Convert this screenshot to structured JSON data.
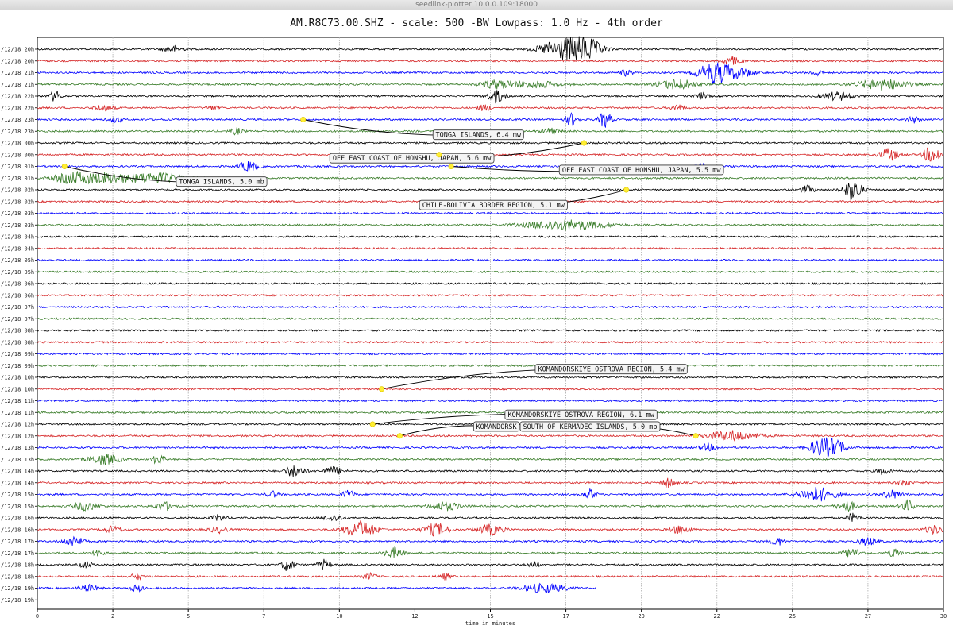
{
  "window": {
    "title": "seedlink-plotter 10.0.0.109:18000"
  },
  "chart_data": {
    "type": "line",
    "title": "AM.R8C73.00.SHZ - scale: 500 -BW Lowpass: 1.0 Hz - 4th order",
    "xlabel": "time in minutes",
    "ylabel": "",
    "xlim": [
      0,
      30
    ],
    "grid": true,
    "x_ticks": [
      "0",
      "2",
      "5",
      "7",
      "10",
      "12",
      "15",
      "17",
      "20",
      "22",
      "25",
      "27",
      "30"
    ],
    "x_tick_values": [
      0,
      2.5,
      5,
      7.5,
      10,
      12.5,
      15,
      17.5,
      20,
      22.5,
      25,
      27.5,
      30
    ],
    "color_cycle": [
      "#000000",
      "#d62728",
      "#0000ff",
      "#3a7d2a"
    ],
    "rows": [
      {
        "label": "/12/18 20h",
        "last_minute": 30,
        "bursts": [
          [
            4.5,
            0.3,
            0.3
          ],
          [
            17.4,
            0.7,
            1.0
          ],
          [
            18.2,
            0.5,
            0.9
          ]
        ]
      },
      {
        "label": "/12/18 20h",
        "last_minute": 30,
        "bursts": [
          [
            23.0,
            0.3,
            0.4
          ]
        ]
      },
      {
        "label": "/12/18 21h",
        "last_minute": 30,
        "bursts": [
          [
            19.5,
            0.2,
            0.3
          ],
          [
            22.4,
            0.5,
            1.0
          ],
          [
            23.2,
            0.5,
            0.5
          ],
          [
            25.8,
            0.2,
            0.3
          ]
        ]
      },
      {
        "label": "/12/18 21h",
        "last_minute": 30,
        "bursts": [
          [
            15.2,
            0.5,
            0.4
          ],
          [
            16.5,
            0.8,
            0.3
          ],
          [
            21.2,
            0.6,
            0.5
          ],
          [
            28.0,
            0.8,
            0.5
          ]
        ]
      },
      {
        "label": "/12/18 22h",
        "last_minute": 30,
        "bursts": [
          [
            0.6,
            0.2,
            0.5
          ],
          [
            15.2,
            0.3,
            0.6
          ],
          [
            22.0,
            0.2,
            0.3
          ],
          [
            26.5,
            0.5,
            0.4
          ]
        ]
      },
      {
        "label": "/12/18 22h",
        "last_minute": 30,
        "bursts": [
          [
            2.2,
            0.3,
            0.3
          ],
          [
            5.8,
            0.2,
            0.2
          ],
          [
            14.8,
            0.2,
            0.3
          ],
          [
            21.2,
            0.2,
            0.3
          ]
        ]
      },
      {
        "label": "/12/18 23h",
        "last_minute": 30,
        "bursts": [
          [
            2.6,
            0.2,
            0.3
          ],
          [
            17.7,
            0.2,
            0.6
          ],
          [
            18.8,
            0.2,
            0.8
          ],
          [
            29.0,
            0.2,
            0.3
          ]
        ]
      },
      {
        "label": "/12/18 23h",
        "last_minute": 30,
        "bursts": [
          [
            6.6,
            0.2,
            0.3
          ],
          [
            17.0,
            0.3,
            0.3
          ]
        ]
      },
      {
        "label": "/12/18 00h",
        "last_minute": 30,
        "bursts": []
      },
      {
        "label": "/12/18 00h",
        "last_minute": 30,
        "bursts": [
          [
            28.2,
            0.3,
            0.6
          ],
          [
            29.5,
            0.2,
            0.6
          ],
          [
            29.8,
            0.2,
            0.5
          ]
        ]
      },
      {
        "label": "/12/18 01h",
        "last_minute": 30,
        "bursts": [
          [
            7.0,
            0.3,
            0.5
          ],
          [
            22.0,
            0.2,
            0.3
          ]
        ]
      },
      {
        "label": "/12/18 01h",
        "last_minute": 30,
        "bursts": [
          [
            1.3,
            0.7,
            0.6
          ],
          [
            2.4,
            0.5,
            0.4
          ],
          [
            3.8,
            1.0,
            0.5
          ]
        ]
      },
      {
        "label": "/12/18 02h",
        "last_minute": 30,
        "bursts": [
          [
            25.5,
            0.2,
            0.4
          ],
          [
            27.0,
            0.3,
            1.0
          ]
        ]
      },
      {
        "label": "/12/18 02h",
        "last_minute": 30,
        "bursts": []
      },
      {
        "label": "/12/18 03h",
        "last_minute": 30,
        "bursts": []
      },
      {
        "label": "/12/18 03h",
        "last_minute": 30,
        "bursts": [
          [
            17.5,
            1.3,
            0.5
          ]
        ]
      },
      {
        "label": "/12/18 04h",
        "last_minute": 30,
        "bursts": []
      },
      {
        "label": "/12/18 04h",
        "last_minute": 30,
        "bursts": []
      },
      {
        "label": "/12/18 05h",
        "last_minute": 30,
        "bursts": []
      },
      {
        "label": "/12/18 05h",
        "last_minute": 30,
        "bursts": []
      },
      {
        "label": "/12/18 06h",
        "last_minute": 30,
        "bursts": []
      },
      {
        "label": "/12/18 06h",
        "last_minute": 30,
        "bursts": []
      },
      {
        "label": "/12/18 07h",
        "last_minute": 30,
        "bursts": []
      },
      {
        "label": "/12/18 07h",
        "last_minute": 30,
        "bursts": []
      },
      {
        "label": "/12/18 08h",
        "last_minute": 30,
        "bursts": []
      },
      {
        "label": "/12/18 08h",
        "last_minute": 30,
        "bursts": []
      },
      {
        "label": "/12/18 09h",
        "last_minute": 30,
        "bursts": []
      },
      {
        "label": "/12/18 09h",
        "last_minute": 30,
        "bursts": []
      },
      {
        "label": "/12/18 10h",
        "last_minute": 30,
        "bursts": []
      },
      {
        "label": "/12/18 10h",
        "last_minute": 30,
        "bursts": []
      },
      {
        "label": "/12/18 11h",
        "last_minute": 30,
        "bursts": []
      },
      {
        "label": "/12/18 11h",
        "last_minute": 30,
        "bursts": []
      },
      {
        "label": "/12/18 12h",
        "last_minute": 30,
        "bursts": []
      },
      {
        "label": "/12/18 12h",
        "last_minute": 30,
        "bursts": [
          [
            23.0,
            0.8,
            0.5
          ]
        ]
      },
      {
        "label": "/12/18 13h",
        "last_minute": 30,
        "bursts": [
          [
            22.2,
            0.3,
            0.3
          ],
          [
            26.0,
            0.4,
            0.9
          ],
          [
            26.5,
            0.3,
            0.5
          ]
        ]
      },
      {
        "label": "/12/18 13h",
        "last_minute": 30,
        "bursts": [
          [
            2.2,
            0.5,
            0.5
          ],
          [
            4.0,
            0.2,
            0.5
          ]
        ]
      },
      {
        "label": "/12/18 14h",
        "last_minute": 30,
        "bursts": [
          [
            8.5,
            0.3,
            0.6
          ],
          [
            9.8,
            0.3,
            0.4
          ],
          [
            28.0,
            0.2,
            0.3
          ]
        ]
      },
      {
        "label": "/12/18 14h",
        "last_minute": 30,
        "bursts": [
          [
            20.9,
            0.2,
            0.5
          ],
          [
            28.7,
            0.2,
            0.3
          ]
        ]
      },
      {
        "label": "/12/18 15h",
        "last_minute": 30,
        "bursts": [
          [
            7.8,
            0.2,
            0.3
          ],
          [
            10.3,
            0.2,
            0.4
          ],
          [
            18.3,
            0.2,
            0.5
          ],
          [
            25.8,
            0.6,
            0.7
          ],
          [
            28.3,
            0.3,
            0.4
          ]
        ]
      },
      {
        "label": "/12/18 15h",
        "last_minute": 30,
        "bursts": [
          [
            1.6,
            0.4,
            0.4
          ],
          [
            4.2,
            0.3,
            0.4
          ],
          [
            13.5,
            0.5,
            0.4
          ],
          [
            26.8,
            0.3,
            0.5
          ],
          [
            28.8,
            0.2,
            0.6
          ]
        ]
      },
      {
        "label": "/12/18 16h",
        "last_minute": 30,
        "bursts": [
          [
            6.0,
            0.2,
            0.3
          ],
          [
            9.8,
            0.3,
            0.3
          ],
          [
            27.0,
            0.2,
            0.4
          ]
        ]
      },
      {
        "label": "/12/18 16h",
        "last_minute": 30,
        "bursts": [
          [
            2.5,
            0.3,
            0.3
          ],
          [
            6.0,
            0.3,
            0.3
          ],
          [
            10.7,
            0.5,
            0.8
          ],
          [
            13.2,
            0.4,
            0.6
          ],
          [
            15.0,
            0.4,
            0.5
          ],
          [
            21.3,
            0.3,
            0.4
          ],
          [
            29.7,
            0.3,
            0.4
          ]
        ]
      },
      {
        "label": "/12/18 17h",
        "last_minute": 30,
        "bursts": [
          [
            1.2,
            0.3,
            0.5
          ],
          [
            24.5,
            0.2,
            0.4
          ],
          [
            27.5,
            0.3,
            0.4
          ]
        ]
      },
      {
        "label": "/12/18 17h",
        "last_minute": 30,
        "bursts": [
          [
            2.0,
            0.2,
            0.3
          ],
          [
            11.8,
            0.3,
            0.5
          ],
          [
            27.0,
            0.3,
            0.4
          ],
          [
            28.4,
            0.2,
            0.4
          ]
        ]
      },
      {
        "label": "/12/18 18h",
        "last_minute": 30,
        "bursts": [
          [
            1.6,
            0.2,
            0.3
          ],
          [
            8.3,
            0.2,
            0.6
          ],
          [
            9.5,
            0.2,
            0.5
          ],
          [
            16.4,
            0.2,
            0.3
          ]
        ]
      },
      {
        "label": "/12/18 18h",
        "last_minute": 30,
        "bursts": [
          [
            3.3,
            0.2,
            0.3
          ],
          [
            11.0,
            0.2,
            0.3
          ],
          [
            13.5,
            0.2,
            0.3
          ]
        ]
      },
      {
        "label": "/12/18 19h",
        "last_minute": 18.5,
        "bursts": [
          [
            1.7,
            0.3,
            0.3
          ],
          [
            3.3,
            0.2,
            0.3
          ],
          [
            16.8,
            0.7,
            0.4
          ]
        ]
      },
      {
        "label": "/12/18 19h",
        "last_minute": 0,
        "bursts": []
      }
    ],
    "annotations": [
      {
        "text": "TONGA ISLANDS, 6.4 mw",
        "row": 6,
        "minute": 8.8,
        "label_minute": 14.6,
        "label_row": 7.3
      },
      {
        "text": "OFF EAST COAST OF HONSHU, JAPAN, 5.6 mw",
        "row": 8,
        "minute": 18.1,
        "label_minute": 12.4,
        "label_row": 9.3
      },
      {
        "text": "",
        "row": 9,
        "minute": 13.3,
        "label_minute": 0,
        "label_row": 0
      },
      {
        "text": "OFF EAST COAST OF HONSHU, JAPAN, 5.5 mw",
        "row": 10,
        "minute": 13.7,
        "label_minute": 20.0,
        "label_row": 10.3
      },
      {
        "text": "TONGA ISLANDS, 5.0 mb",
        "row": 10,
        "minute": 0.9,
        "label_minute": 6.1,
        "label_row": 11.3
      },
      {
        "text": "CHILE-BOLIVIA BORDER REGION, 5.1 mw",
        "row": 12,
        "minute": 19.5,
        "label_minute": 15.1,
        "label_row": 13.3
      },
      {
        "text": "KOMANDORSKIYE OSTROVA REGION, 5.4 mw",
        "row": 29,
        "minute": 11.4,
        "label_minute": 19.0,
        "label_row": 27.3
      },
      {
        "text": "KOMANDORSKIYE OSTROVA REGION, 6.1 mw",
        "row": 32,
        "minute": 11.1,
        "label_minute": 18.0,
        "label_row": 31.2
      },
      {
        "text": "KOMANDORSK",
        "row": 33,
        "minute": 12.0,
        "label_minute": 15.2,
        "label_row": 32.2
      },
      {
        "text": "SOUTH OF KERMADEC ISLANDS, 5.0 mb",
        "row": 33,
        "minute": 21.8,
        "label_minute": 18.3,
        "label_row": 32.2
      }
    ]
  }
}
